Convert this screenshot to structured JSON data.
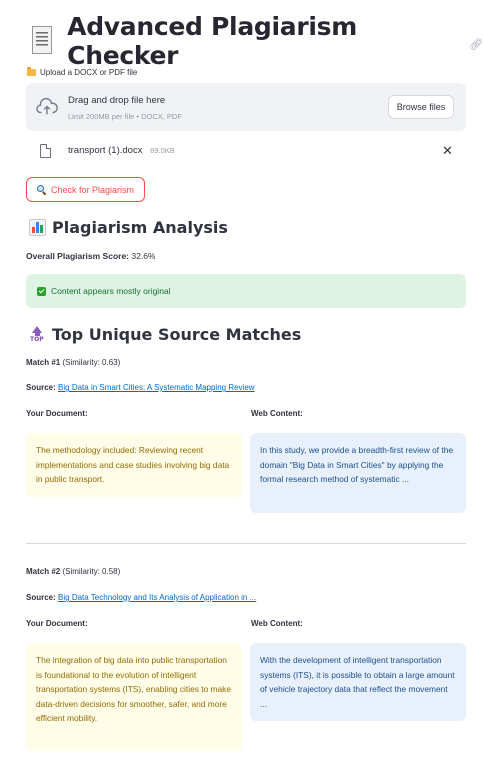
{
  "title": "Advanced Plagiarism Checker",
  "upload": {
    "label": "Upload a DOCX or PDF file",
    "drop_title": "Drag and drop file here",
    "drop_sub": "Limit 200MB per file • DOCX, PDF",
    "browse_label": "Browse files"
  },
  "file": {
    "name": "transport (1).docx",
    "size": "69.0KB"
  },
  "check_button": "Check for Plagiarism",
  "analysis": {
    "heading": "Plagiarism Analysis",
    "score_label": "Overall Plagiarism Score:",
    "score_value": "32.6%",
    "status": "Content appears mostly original"
  },
  "matches_heading": "Top Unique Source Matches",
  "your_doc_label": "Your Document:",
  "web_label": "Web Content:",
  "source_label": "Source:",
  "matches": [
    {
      "title": "Match #1",
      "similarity": "(Similarity: 0.63)",
      "source": "Big Data in Smart Cities: A Systematic Mapping Review",
      "your_text": "The methodology included: Reviewing recent implementations and case studies involving big data in public transport.",
      "web_text": "In this study, we provide a breadth-first review of the domain \"Big Data in Smart Cities\" by applying the formal research method of systematic ..."
    },
    {
      "title": "Match #2",
      "similarity": "(Similarity: 0.58)",
      "source": "Big Data Technology and Its Analysis of Application in ...",
      "your_text": "The integration of big data into public transportation is foundational to the evolution of intelligent transportation systems (ITS), enabling cities to make data-driven decisions for smoother, safer, and more efficient mobility.",
      "web_text": "With the development of intelligent transportation systems (ITS), it is possible to obtain a large amount of vehicle trajectory data that reflect the movement ..."
    }
  ],
  "colors": {
    "accent": "#ff4b4b",
    "link": "#0068c9",
    "success_bg": "#dff3e4",
    "yellow_box": "#fffce7",
    "blue_box": "#e8f1fb"
  }
}
